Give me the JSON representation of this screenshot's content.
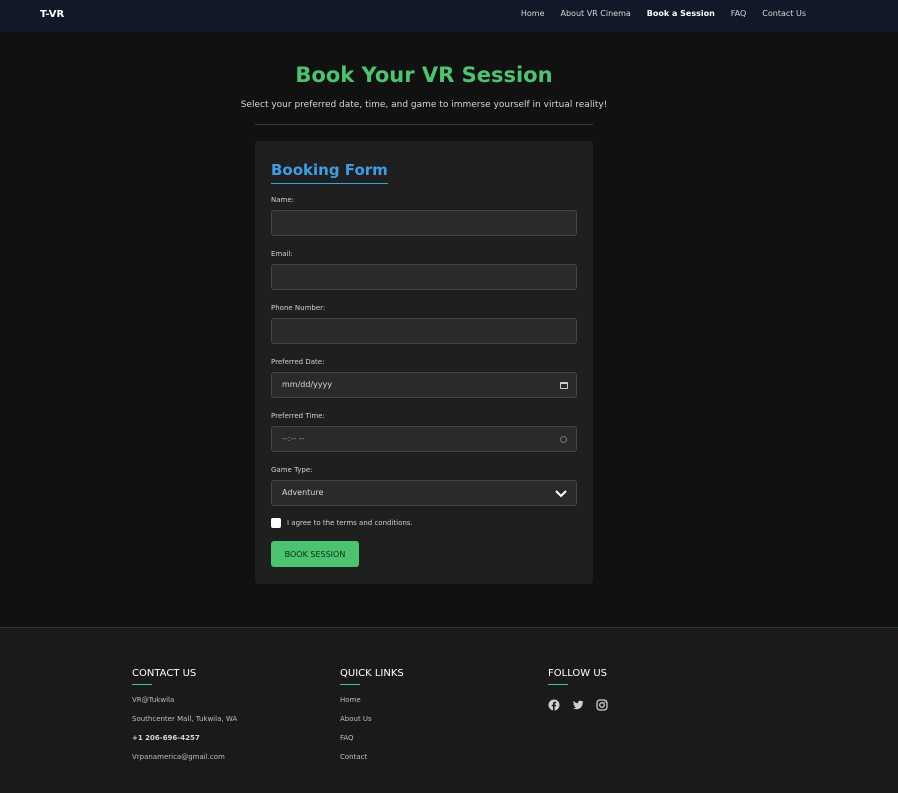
{
  "nav": {
    "brand": "T-VR",
    "links": [
      {
        "label": "Home"
      },
      {
        "label": "About VR Cinema"
      },
      {
        "label": "Book a Session",
        "active": true
      },
      {
        "label": "FAQ"
      },
      {
        "label": "Contact Us"
      }
    ]
  },
  "hero": {
    "title": "Book Your VR Session",
    "subtitle": "Select your preferred date, time, and game to immerse yourself in virtual reality!"
  },
  "form": {
    "title": "Booking Form",
    "name_label": "Name:",
    "email_label": "Email:",
    "phone_label": "Phone Number:",
    "date_label": "Preferred Date:",
    "date_placeholder": "mm/dd/yyyy",
    "time_label": "Preferred Time:",
    "time_placeholder": "--:-- --",
    "game_label": "Game Type:",
    "game_selected": "Adventure",
    "terms_label": "I agree to the terms and conditions.",
    "submit_label": "BOOK SESSION"
  },
  "footer": {
    "contact": {
      "heading": "CONTACT US",
      "name": "VR@Tukwila",
      "address": "Southcenter Mall, Tukwila, WA",
      "phone": "+1 206-696-4257",
      "email": "Vrpanamerica@gmail.com"
    },
    "links": {
      "heading": "QUICK LINKS",
      "items": [
        "Home",
        "About Us",
        "FAQ",
        "Contact"
      ]
    },
    "follow": {
      "heading": "FOLLOW US",
      "icons": [
        "facebook-icon",
        "twitter-icon",
        "instagram-icon"
      ]
    }
  },
  "colors": {
    "accent_green": "#4cc46f",
    "accent_blue": "#3b9fe6",
    "background": "#111111",
    "nav_background": "#111827"
  }
}
